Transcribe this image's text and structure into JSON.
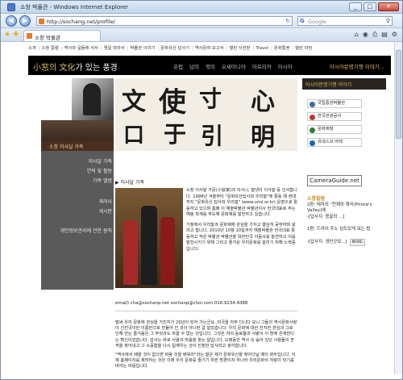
{
  "window": {
    "title": "소창 박물관 - Windows Internet Explorer",
    "address": "http://sochang.net/profile/",
    "search_placeholder": "Google",
    "tab_label": "소창 박물관"
  },
  "top_menu": [
    "소개",
    "소창 칼럼",
    "역사와 길들에 서서",
    "옛길 따라서",
    "박물관 이야기",
    "문화유산 답사기",
    "역사문화 보고서",
    "열린 사진판",
    "Travel",
    "문화통권",
    "열린 마당"
  ],
  "banner": {
    "logo_prefix": "小窓",
    "logo_mid": "의 文化",
    "logo_suffix": "가 있는 풍경",
    "menu": [
      "유럽",
      "남미",
      "북미",
      "오세아니아",
      "아프리카",
      "아시아"
    ],
    "slogan": "아시아문명기행 이야기..."
  },
  "sidebar": {
    "title": "소창 이사달 가족",
    "items": [
      "이사달 가족",
      "연혁 및 활동",
      "가족 앨범",
      "격려사",
      "게시판",
      "개인정보관리에 관한 원칙"
    ]
  },
  "main": {
    "breadcrumb": "▶ 이사달 가족",
    "intro_p1": "소창 이사달 가문(小窓家)과 이사니, 딸넷이 이사달 등 인서합니다. 1998년 겨울부터 \"문화유산답사와 우리말\"에 활동 해 현대까지 \"문화유산 답사와 우리말\" (www.urisl.or.kr) 운영으로 활동하고 있으며 홈페 이 예술박물관 박물관이사 한국대표로 주는 예술 학계를 주도해 문화재를 발전하고 있습니다.",
    "intro_p2": "기정에서 우리말과 문화재에 관심을 가지고 열심히 공부하며 살려고 합니다. 2010년 10월 10일까지 예술박물관 한국대표 활동하고 작은 박물관 박물관을 대한민국 이중사를 발견하고 이를 발전시키기 위해 그리고 즐거운 우리문화를 알리기 위해 노력중입니다.",
    "email": "email) cha@sochanp.net sochanp@chol.com 016-9234-9388",
    "body_p1": "벌써 우리 문화에 관심을 가진지가 20년이 되어 가는군요. 외국을 자주 다니다 보니 그들의 역사문화사랑이 선진국이란 이름만으로 만들어 진 것이 아니란 걸 알았습니다. 우리 문화에 대한 진지한 관심과 그로 인해 얻는 즐거움은 그 무엇과도 바꿀 수 없는 것입니다. 그것은 저의 동료들과 사랑이 이 땅에 존재한다는 확인이었습니다. 답사는 바로 사람의 마음을 찾는 일입니다. 오랫동안 역사 속 숨어 있던 사람들의 흔적을 찾아내고 그 소중함을 다시 일깨우는 것이 진정한 답사라고 생각합니다.",
    "body_p2": "\"역사에서 배울 것이 없으면 바람 것을 배워라\"라는 말은 제가 문화유산을 찾아다닐 때의 화두입니다. 이제 홈페이지를 제작하는 것은 이제 우리 문화를 즐기기 위한 방편이자 하나라 우리문화의 자랑이 되기를 바라는 마음입니다."
  },
  "right": {
    "top_banner": "아시아문명기행 이야기",
    "logos": [
      "국립중앙박물관",
      "한국관광공사",
      "문화재청",
      "유네스코 아태"
    ],
    "logo_colors": [
      "#3a6aa8",
      "#c0392b",
      "#2e7d32",
      "#1565c0"
    ],
    "camera_guide": "CameraGuide.net",
    "section_title": "소창칼럼",
    "items": [
      "2편: 테자의 \"천제의 계곡(Prince's Valley)에",
      "-[답사지: 몽골의 ...]",
      "1편: 드라이 주노 심도있게 보는 법",
      "-[답사지: 경안군묘...]"
    ],
    "more": "MORE"
  },
  "colors": {
    "banner_bg": "#000000",
    "sidebar_bg": "#5a5a5a",
    "accent": "#c7831b"
  }
}
